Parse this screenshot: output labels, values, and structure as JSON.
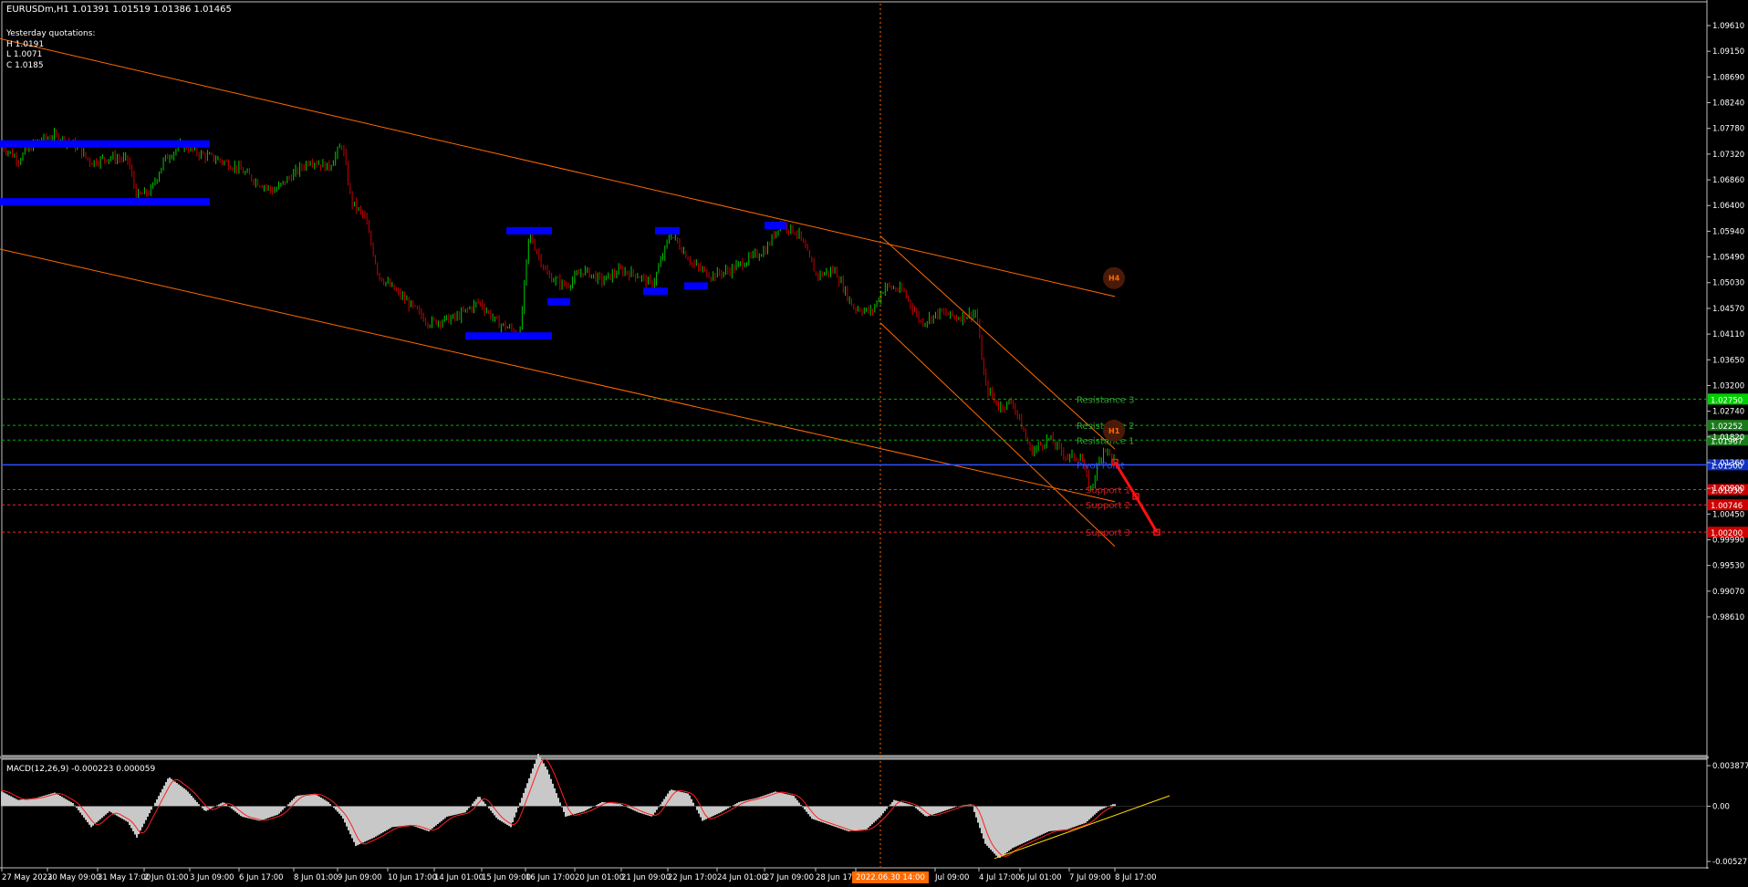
{
  "header": {
    "symbol_line": "EURUSDm,H1  1.01391 1.01519 1.01386 1.01465",
    "yesterday_title": "Yesterday quotations:",
    "yesterday_high": "H 1.0191",
    "yesterday_low": "L 1.0071",
    "yesterday_close": "C 1.0185"
  },
  "macd": {
    "label": "MACD(12,26,9) -0.000223 0.000059"
  },
  "colors": {
    "background": "#000000",
    "bull_candle": "#00c800",
    "bear_candle": "#c80000",
    "zone": "#0000ff",
    "channel": "#ff6a00",
    "resistance": "#00b400",
    "support": "#ff2020",
    "pivot": "#3050ff",
    "histogram": "#c8c8c8",
    "signal": "#ff2020",
    "trend_yellow": "#ffd800"
  },
  "chart_data": [
    {
      "type": "candlestick",
      "timeframe": "H1",
      "x_ticks": [
        "27 May 2022",
        "30 May 09:00",
        "31 May 17:00",
        "2 Jun 01:00",
        "3 Jun 09:00",
        "6 Jun 17:00",
        "8 Jun 01:00",
        "9 Jun 09:00",
        "10 Jun 17:00",
        "14 Jun 01:00",
        "15 Jun 09:00",
        "16 Jun 17:00",
        "20 Jun 01:00",
        "21 Jun 09:00",
        "22 Jun 17:00",
        "24 Jun 01:00",
        "27 Jun 09:00",
        "28 Jun 17:00",
        "2022.06.30 14:00",
        "Jul 09:00",
        "4 Jul 17:00",
        "6 Jul 01:00",
        "7 Jul 09:00",
        "8 Jul 17:00"
      ],
      "y_ticks": [
        "1.09610",
        "1.09150",
        "1.08690",
        "1.08240",
        "1.07780",
        "1.07320",
        "1.06860",
        "1.06400",
        "1.05940",
        "1.05490",
        "1.05030",
        "1.04570",
        "1.04110",
        "1.03650",
        "1.03200",
        "1.02740",
        "1.01820",
        "1.01360",
        "1.00900",
        "1.00450",
        "0.99990",
        "0.99530",
        "0.99070",
        "0.98610"
      ],
      "ylim": [
        0.9861,
        1.0985
      ],
      "close_path": [
        [
          0,
          1.076
        ],
        [
          20,
          1.073
        ],
        [
          40,
          1.0765
        ],
        [
          60,
          1.0775
        ],
        [
          80,
          1.076
        ],
        [
          100,
          1.0725
        ],
        [
          120,
          1.0735
        ],
        [
          140,
          1.073
        ],
        [
          150,
          1.066
        ],
        [
          165,
          1.067
        ],
        [
          180,
          1.073
        ],
        [
          200,
          1.076
        ],
        [
          220,
          1.074
        ],
        [
          240,
          1.073
        ],
        [
          260,
          1.0715
        ],
        [
          280,
          1.069
        ],
        [
          300,
          1.067
        ],
        [
          320,
          1.07
        ],
        [
          340,
          1.073
        ],
        [
          360,
          1.0715
        ],
        [
          375,
          1.076
        ],
        [
          385,
          1.065
        ],
        [
          400,
          1.062
        ],
        [
          415,
          1.051
        ],
        [
          440,
          1.047
        ],
        [
          470,
          1.042
        ],
        [
          500,
          1.043
        ],
        [
          525,
          1.046
        ],
        [
          545,
          1.042
        ],
        [
          570,
          1.04
        ],
        [
          580,
          1.059
        ],
        [
          600,
          1.051
        ],
        [
          620,
          1.049
        ],
        [
          640,
          1.052
        ],
        [
          660,
          1.05
        ],
        [
          680,
          1.052
        ],
        [
          700,
          1.051
        ],
        [
          715,
          1.049
        ],
        [
          735,
          1.059
        ],
        [
          760,
          1.053
        ],
        [
          780,
          1.051
        ],
        [
          800,
          1.052
        ],
        [
          820,
          1.054
        ],
        [
          840,
          1.056
        ],
        [
          855,
          1.061
        ],
        [
          875,
          1.059
        ],
        [
          895,
          1.051
        ],
        [
          915,
          1.052
        ],
        [
          935,
          1.045
        ],
        [
          955,
          1.044
        ],
        [
          970,
          1.049
        ],
        [
          990,
          1.048
        ],
        [
          1010,
          1.042
        ],
        [
          1030,
          1.044
        ],
        [
          1050,
          1.043
        ],
        [
          1070,
          1.044
        ],
        [
          1080,
          1.03
        ],
        [
          1095,
          1.026
        ],
        [
          1110,
          1.027
        ],
        [
          1130,
          1.0175
        ],
        [
          1150,
          1.02
        ],
        [
          1170,
          1.0165
        ],
        [
          1185,
          1.0165
        ],
        [
          1195,
          1.01
        ],
        [
          1210,
          1.0185
        ],
        [
          1220,
          1.016
        ]
      ],
      "zones_blue": [
        {
          "x": [
            0,
            230
          ],
          "y": 1.076
        },
        {
          "x": [
            0,
            230
          ],
          "y": 1.065
        },
        {
          "x": [
            555,
            605
          ],
          "y": 1.0595
        },
        {
          "x": [
            600,
            625
          ],
          "y": 1.046
        },
        {
          "x": [
            510,
            605
          ],
          "y": 1.0395
        },
        {
          "x": [
            718,
            745
          ],
          "y": 1.0595
        },
        {
          "x": [
            705,
            732
          ],
          "y": 1.048
        },
        {
          "x": [
            750,
            776
          ],
          "y": 1.049
        },
        {
          "x": [
            838,
            862
          ],
          "y": 1.0605
        }
      ],
      "channel_lines": [
        {
          "from": [
            0,
            1.096
          ],
          "to": [
            1222,
            1.047
          ]
        },
        {
          "from": [
            0,
            1.056
          ],
          "to": [
            1222,
            1.008
          ]
        },
        {
          "from": [
            965,
            1.0585
          ],
          "to": [
            1222,
            1.018
          ]
        },
        {
          "from": [
            965,
            1.042
          ],
          "to": [
            1222,
            0.9995
          ]
        }
      ],
      "levels": [
        {
          "name": "Resistance 3",
          "value": 1.0275,
          "tag": "1.02750"
        },
        {
          "name": "Resistance 2",
          "value": 1.0225,
          "tag": "1.02252"
        },
        {
          "name": "Resistance 1",
          "value": 1.0197,
          "tag": "1.01967"
        },
        {
          "name": "Pivot Point",
          "value": 1.015,
          "tag": "1.01500"
        },
        {
          "name": "Support 1",
          "value": 1.0103,
          "tag": "1.01030"
        },
        {
          "name": "Support 2",
          "value": 1.0074,
          "tag": "1.00746"
        },
        {
          "name": "Support 3",
          "value": 1.0022,
          "tag": "1.00200"
        }
      ],
      "projection": [
        [
          1222,
          1.0155
        ],
        [
          1245,
          1.009
        ],
        [
          1268,
          1.0022
        ]
      ],
      "markers": [
        "H4",
        "H1"
      ],
      "vertical_line_at": 965,
      "grid": false
    },
    {
      "type": "histogram",
      "name": "MACD(12,26,9)",
      "y_ticks": [
        "0.003877",
        "0.00",
        "-0.005277"
      ],
      "ylim": [
        -0.005277,
        0.003877
      ],
      "hist_path": [
        [
          0,
          0.0015
        ],
        [
          20,
          0.0006
        ],
        [
          40,
          0.0008
        ],
        [
          60,
          0.0013
        ],
        [
          80,
          0.0003
        ],
        [
          100,
          -0.002
        ],
        [
          120,
          -0.0005
        ],
        [
          140,
          -0.0015
        ],
        [
          150,
          -0.003
        ],
        [
          165,
          -0.0005
        ],
        [
          185,
          0.0028
        ],
        [
          205,
          0.0015
        ],
        [
          225,
          -0.0005
        ],
        [
          245,
          0.0004
        ],
        [
          265,
          -0.001
        ],
        [
          285,
          -0.0014
        ],
        [
          305,
          -0.0008
        ],
        [
          325,
          0.001
        ],
        [
          345,
          0.0012
        ],
        [
          360,
          0.0004
        ],
        [
          375,
          -0.001
        ],
        [
          390,
          -0.0038
        ],
        [
          410,
          -0.003
        ],
        [
          430,
          -0.002
        ],
        [
          450,
          -0.0018
        ],
        [
          470,
          -0.0024
        ],
        [
          490,
          -0.001
        ],
        [
          510,
          -0.0006
        ],
        [
          525,
          0.001
        ],
        [
          545,
          -0.0012
        ],
        [
          560,
          -0.002
        ],
        [
          575,
          0.0015
        ],
        [
          590,
          0.005
        ],
        [
          600,
          0.0035
        ],
        [
          620,
          -0.001
        ],
        [
          640,
          -0.0005
        ],
        [
          660,
          0.0004
        ],
        [
          680,
          0.0002
        ],
        [
          700,
          -0.0006
        ],
        [
          715,
          -0.001
        ],
        [
          735,
          0.0016
        ],
        [
          755,
          0.0012
        ],
        [
          770,
          -0.0014
        ],
        [
          790,
          -0.0006
        ],
        [
          810,
          0.0004
        ],
        [
          830,
          0.0008
        ],
        [
          850,
          0.0014
        ],
        [
          870,
          0.001
        ],
        [
          890,
          -0.0012
        ],
        [
          910,
          -0.0018
        ],
        [
          930,
          -0.0024
        ],
        [
          950,
          -0.0022
        ],
        [
          965,
          -0.001
        ],
        [
          980,
          0.0006
        ],
        [
          1000,
          0.0001
        ],
        [
          1015,
          -0.001
        ],
        [
          1030,
          -0.0006
        ],
        [
          1050,
          0.0
        ],
        [
          1065,
          0.0002
        ],
        [
          1080,
          -0.0036
        ],
        [
          1095,
          -0.005
        ],
        [
          1110,
          -0.004
        ],
        [
          1130,
          -0.0032
        ],
        [
          1150,
          -0.0024
        ],
        [
          1170,
          -0.0022
        ],
        [
          1190,
          -0.0016
        ],
        [
          1205,
          -0.0004
        ],
        [
          1220,
          0.0002
        ]
      ],
      "trendline": {
        "from": [
          1090,
          -0.005
        ],
        "to": [
          1282,
          0.001
        ]
      }
    }
  ]
}
